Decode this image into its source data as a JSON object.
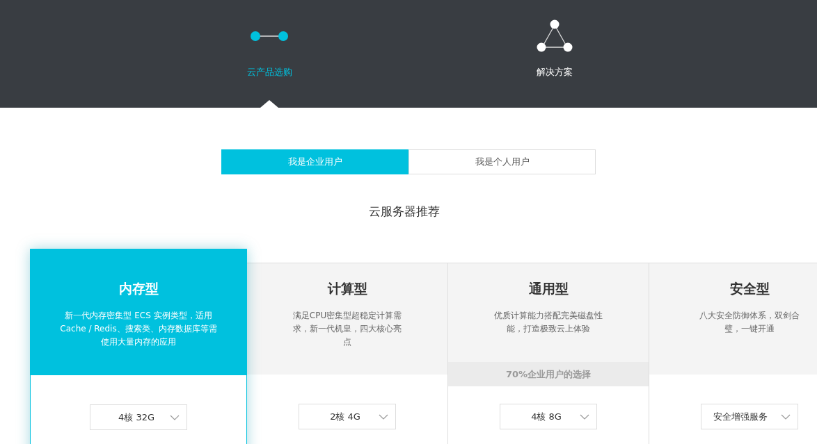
{
  "nav": [
    {
      "label": "云产品选购",
      "selected": true
    },
    {
      "label": "解决方案",
      "selected": false
    }
  ],
  "tabs": [
    {
      "label": "我是企业用户",
      "selected": true
    },
    {
      "label": "我是个人用户",
      "selected": false
    }
  ],
  "section_title": "云服务器推荐",
  "cards": [
    {
      "title": "内存型",
      "description": "新一代内存密集型 ECS 实例类型，适用 Cache / Redis、搜索类、内存数据库等需使用大量内存的应用",
      "selected": true,
      "spec": "4核 32G"
    },
    {
      "title": "计算型",
      "description": "满足CPU密集型超稳定计算需求，新一代机皇，四大核心亮点",
      "selected": false,
      "spec": "2核 4G"
    },
    {
      "title": "通用型",
      "description": "优质计算能力搭配完美磁盘性能，打造极致云上体验",
      "selected": false,
      "badge": "70%企业用户的选择",
      "spec": "4核 8G"
    },
    {
      "title": "安全型",
      "description": "八大安全防御体系，双剑合璧，一键开通",
      "selected": false,
      "spec": "安全增强服务"
    }
  ]
}
